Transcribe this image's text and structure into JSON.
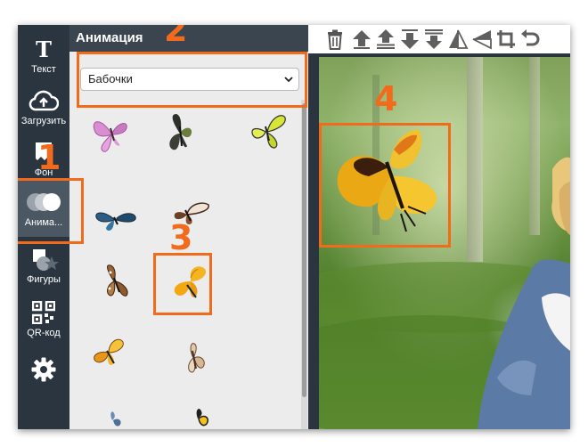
{
  "sidebar": {
    "items": [
      {
        "label": "Текст",
        "icon": "text-tool-icon"
      },
      {
        "label": "Загрузить",
        "icon": "cloud-upload-icon"
      },
      {
        "label": "Фон",
        "icon": "background-icon"
      },
      {
        "label": "Анима...",
        "icon": "animation-circles-icon",
        "active": true
      },
      {
        "label": "Фигуры",
        "icon": "shapes-icon"
      },
      {
        "label": "QR-код",
        "icon": "qr-code-icon"
      },
      {
        "label": "",
        "icon": "gear-icon"
      }
    ]
  },
  "panel": {
    "title": "Анимация",
    "category_select": {
      "value": "Бабочки"
    },
    "items": [
      {
        "name": "pink-butterfly"
      },
      {
        "name": "dark-butterfly"
      },
      {
        "name": "lime-butterfly"
      },
      {
        "name": "blue-butterfly"
      },
      {
        "name": "brown-white-butterfly"
      },
      {
        "name": "spotted-brown-butterfly"
      },
      {
        "name": "yellow-orange-butterfly"
      },
      {
        "name": "orange-yellow-butterfly"
      },
      {
        "name": "tan-butterfly"
      },
      {
        "name": "small-blue-butterfly"
      },
      {
        "name": "black-yellow-butterfly"
      }
    ]
  },
  "toolbar": {
    "tools": [
      "trash-icon",
      "bring-forward-icon",
      "bring-to-front-icon",
      "send-backward-icon",
      "send-to-back-icon",
      "flip-vertical-icon",
      "flip-horizontal-icon",
      "crop-icon",
      "rotate-icon"
    ]
  },
  "annotations": {
    "labels": [
      "1",
      "2",
      "3",
      "4"
    ],
    "color": "#f26a1b"
  },
  "colors": {
    "rail_bg": "#2b353f",
    "panel_bg": "#ececec",
    "header_bg": "#3a4550",
    "accent": "#f26a1b"
  }
}
